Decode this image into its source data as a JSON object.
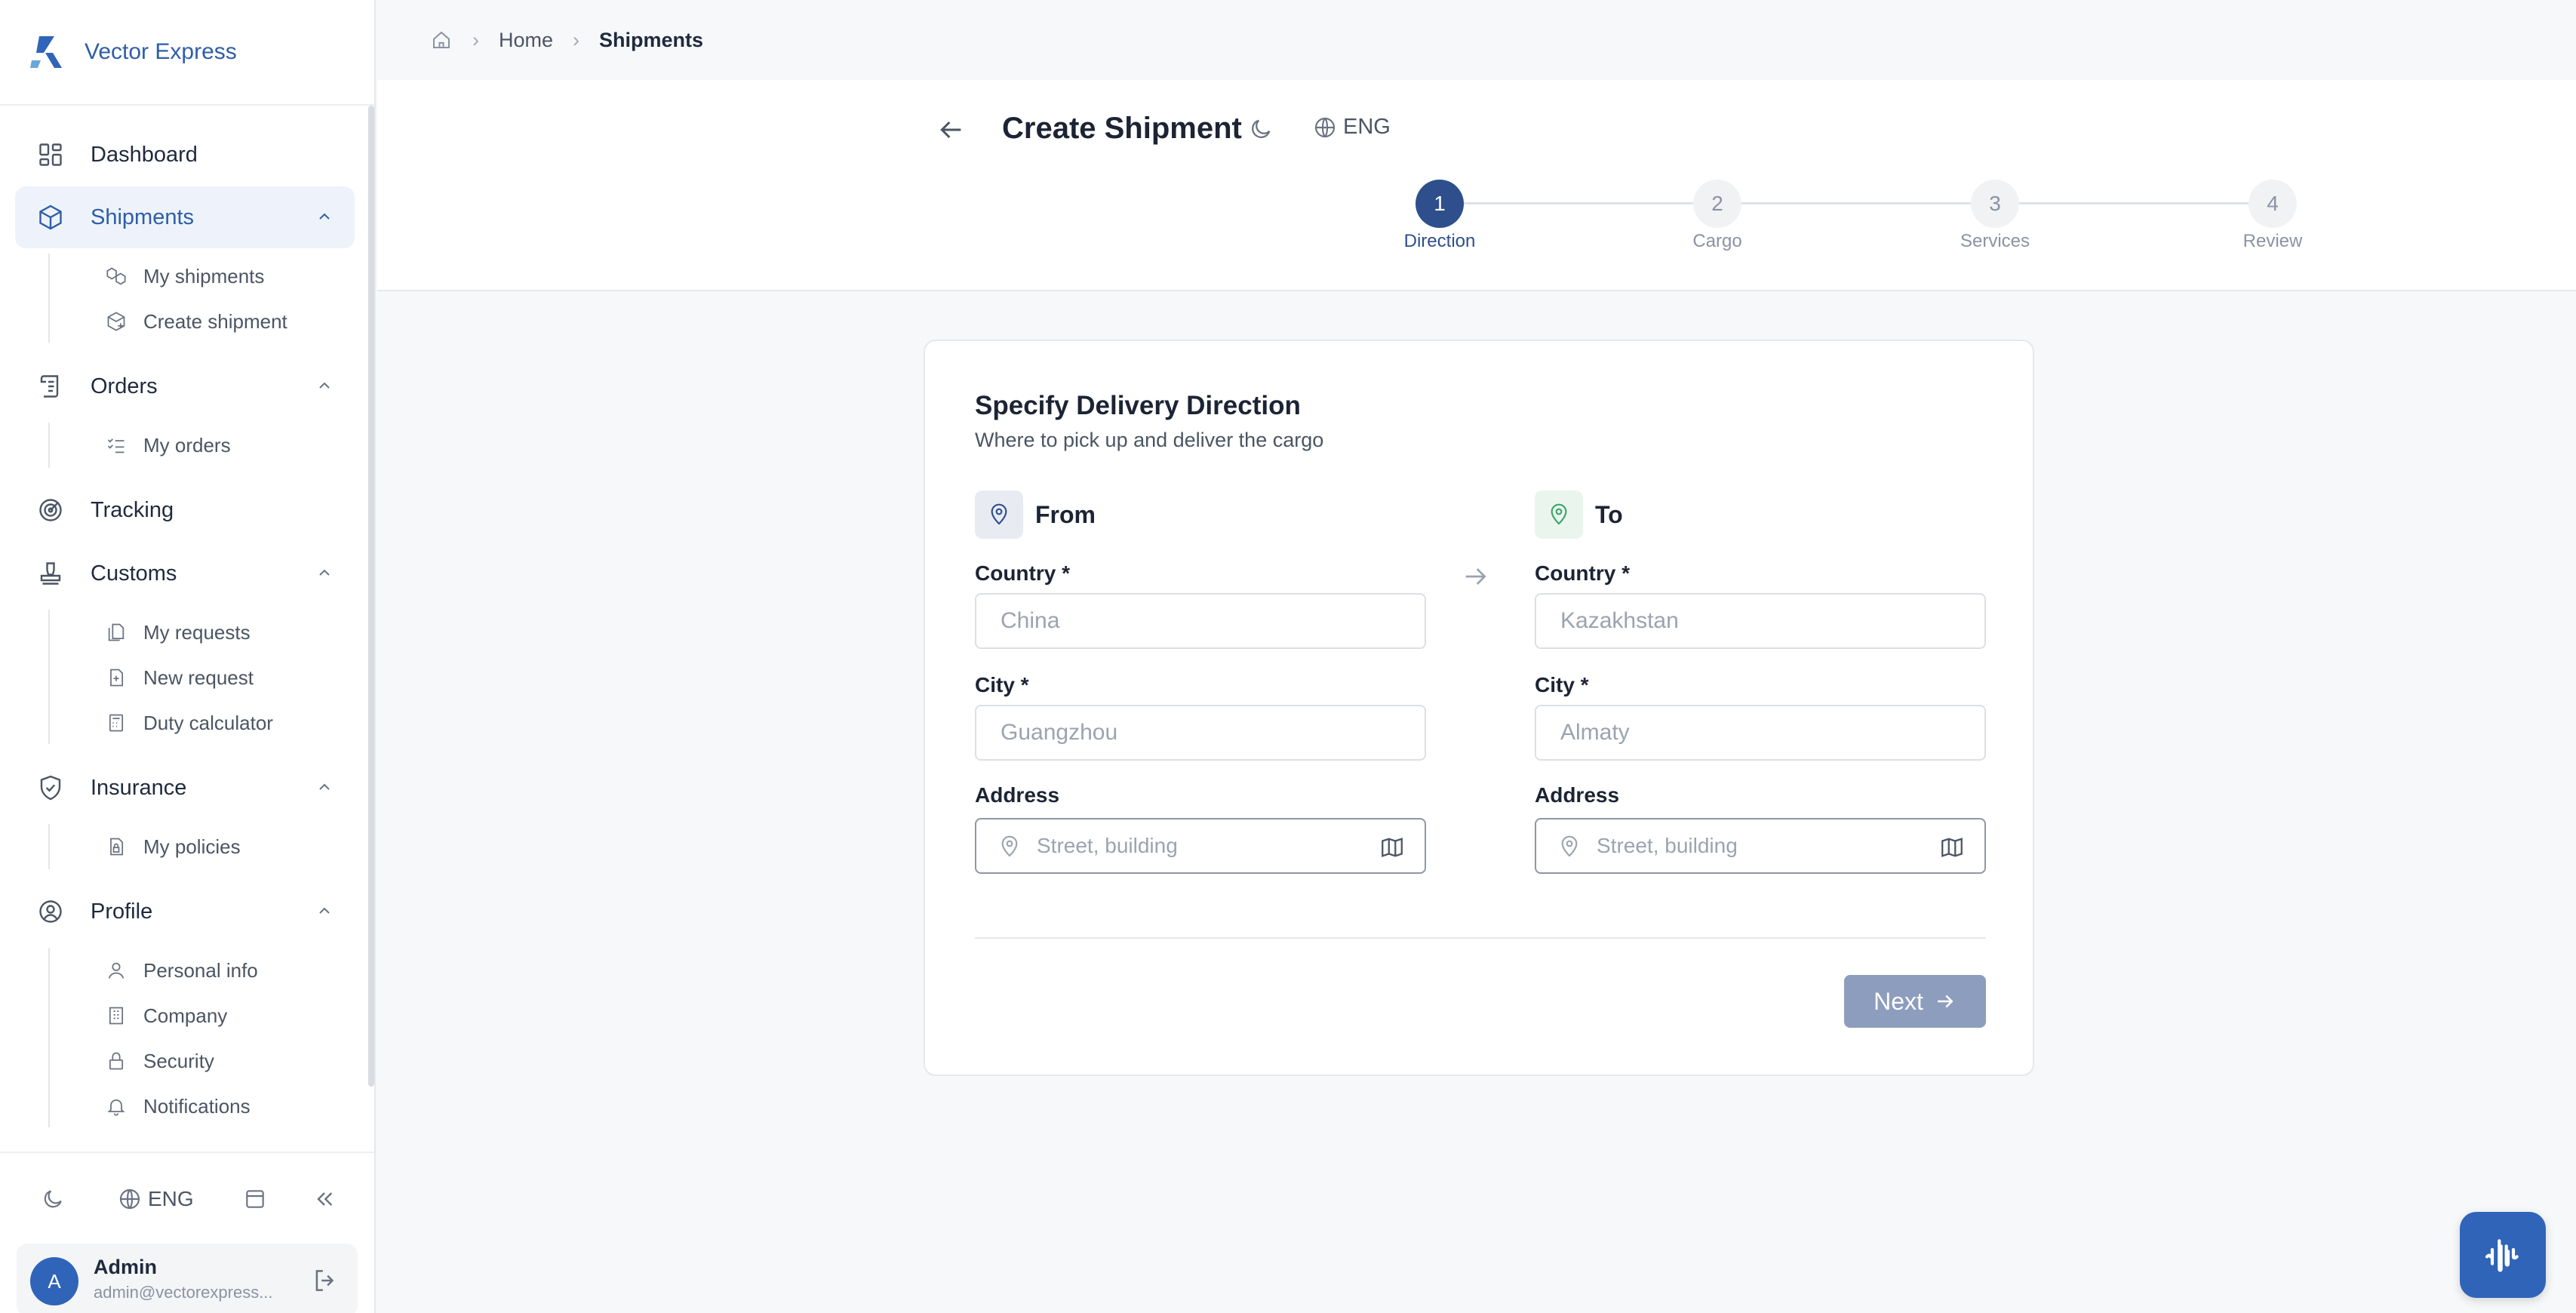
{
  "brand": {
    "name": "Vector Express",
    "color": "#2e5ea8"
  },
  "sidebar": {
    "items": [
      {
        "label": "Dashboard",
        "icon": "dashboard-icon"
      },
      {
        "label": "Shipments",
        "icon": "box-icon",
        "active": true,
        "children": [
          {
            "label": "My shipments",
            "icon": "boxes-icon"
          },
          {
            "label": "Create shipment",
            "icon": "box-plus-icon"
          }
        ]
      },
      {
        "label": "Orders",
        "icon": "scroll-icon",
        "children": [
          {
            "label": "My orders",
            "icon": "list-check-icon"
          }
        ]
      },
      {
        "label": "Tracking",
        "icon": "radar-icon"
      },
      {
        "label": "Customs",
        "icon": "stamp-icon",
        "children": [
          {
            "label": "My requests",
            "icon": "files-icon"
          },
          {
            "label": "New request",
            "icon": "file-plus-icon"
          },
          {
            "label": "Duty calculator",
            "icon": "calculator-icon"
          }
        ]
      },
      {
        "label": "Insurance",
        "icon": "shield-check-icon",
        "children": [
          {
            "label": "My policies",
            "icon": "file-lock-icon"
          }
        ]
      },
      {
        "label": "Profile",
        "icon": "user-circle-icon",
        "children": [
          {
            "label": "Personal info",
            "icon": "user-icon"
          },
          {
            "label": "Company",
            "icon": "building-icon"
          },
          {
            "label": "Security",
            "icon": "lock-icon"
          },
          {
            "label": "Notifications",
            "icon": "bell-icon"
          }
        ]
      }
    ],
    "bottom": {
      "lang": "ENG"
    },
    "user": {
      "initial": "A",
      "name": "Admin",
      "email": "admin@vectorexpress..."
    }
  },
  "breadcrumb": {
    "home": "Home",
    "current": "Shipments"
  },
  "header": {
    "title": "Create Shipment",
    "lang": "ENG"
  },
  "stepper": {
    "steps": [
      {
        "num": "1",
        "label": "Direction",
        "active": true
      },
      {
        "num": "2",
        "label": "Cargo"
      },
      {
        "num": "3",
        "label": "Services"
      },
      {
        "num": "4",
        "label": "Review"
      }
    ]
  },
  "form": {
    "title": "Specify Delivery Direction",
    "subtitle": "Where to pick up and deliver the cargo",
    "from": {
      "heading": "From",
      "country_label": "Country *",
      "country_placeholder": "China",
      "city_label": "City *",
      "city_placeholder": "Guangzhou",
      "address_label": "Address",
      "address_placeholder": "Street, building"
    },
    "to": {
      "heading": "To",
      "country_label": "Country *",
      "country_placeholder": "Kazakhstan",
      "city_label": "City *",
      "city_placeholder": "Almaty",
      "address_label": "Address",
      "address_placeholder": "Street, building"
    },
    "next_label": "Next"
  },
  "colors": {
    "accent": "#2f64b9",
    "step_active": "#2e4f8c",
    "next_disabled": "#8d9dbd"
  }
}
